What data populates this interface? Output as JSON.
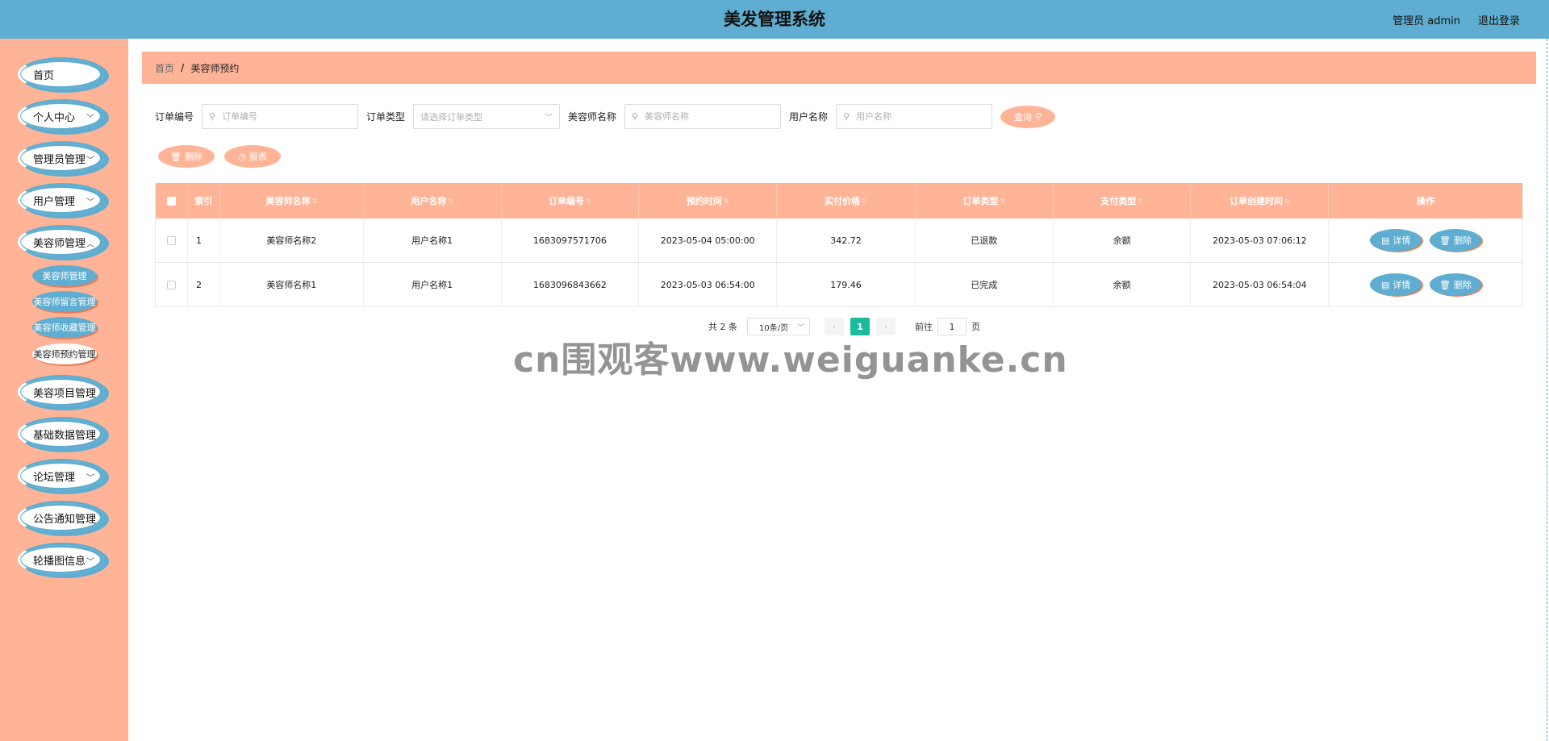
{
  "header": {
    "title": "美发管理系统",
    "user": "管理员 admin",
    "logout": "退出登录"
  },
  "sidebar": {
    "items": [
      {
        "label": "首页",
        "has_children": false
      },
      {
        "label": "个人中心",
        "has_children": true
      },
      {
        "label": "管理员管理",
        "has_children": true
      },
      {
        "label": "用户管理",
        "has_children": true
      },
      {
        "label": "美容师管理",
        "has_children": true,
        "expanded": true
      },
      {
        "label": "美容项目管理",
        "has_children": true
      },
      {
        "label": "基础数据管理",
        "has_children": true
      },
      {
        "label": "论坛管理",
        "has_children": true
      },
      {
        "label": "公告通知管理",
        "has_children": true
      },
      {
        "label": "轮播图信息",
        "has_children": true
      }
    ],
    "submenu": [
      {
        "label": "美容师管理"
      },
      {
        "label": "美容师留言管理"
      },
      {
        "label": "美容师收藏管理"
      },
      {
        "label": "美容师预约管理",
        "active": true
      }
    ]
  },
  "breadcrumb": {
    "home": "首页",
    "separator": "/",
    "current": "美容师预约"
  },
  "search": {
    "order_no_label": "订单编号",
    "order_no_placeholder": "订单编号",
    "order_type_label": "订单类型",
    "order_type_placeholder": "请选择订单类型",
    "stylist_label": "美容师名称",
    "stylist_placeholder": "美容师名称",
    "user_label": "用户名称",
    "user_placeholder": "用户名称",
    "query_button": "查询"
  },
  "actions": {
    "delete": "删除",
    "report": "报表"
  },
  "table": {
    "columns": [
      "索引",
      "美容师名称",
      "用户名称",
      "订单编号",
      "预约时间",
      "实付价格",
      "订单类型",
      "支付类型",
      "订单创建时间",
      "操作"
    ],
    "rows": [
      {
        "index": "1",
        "stylist": "美容师名称2",
        "user": "用户名称1",
        "order_no": "1683097571706",
        "appointment_time": "2023-05-04 05:00:00",
        "price": "342.72",
        "order_type": "已退款",
        "pay_type": "余额",
        "created": "2023-05-03 07:06:12"
      },
      {
        "index": "2",
        "stylist": "美容师名称1",
        "user": "用户名称1",
        "order_no": "1683096843662",
        "appointment_time": "2023-05-03 06:54:00",
        "price": "179.46",
        "order_type": "已完成",
        "pay_type": "余额",
        "created": "2023-05-03 06:54:04"
      }
    ],
    "detail_button": "详情",
    "delete_button": "删除"
  },
  "pagination": {
    "total": "共 2 条",
    "page_size": "10条/页",
    "current_page": "1",
    "goto_prefix": "前往",
    "goto_value": "1",
    "goto_suffix": "页"
  },
  "watermark": "cn围观客www.weiguanke.cn",
  "colors": {
    "header": "#5fadd0",
    "sidebar": "#ffb498",
    "accent": "#ffb498",
    "button_blue": "#5fadd0",
    "page_active": "#1abc9c"
  }
}
